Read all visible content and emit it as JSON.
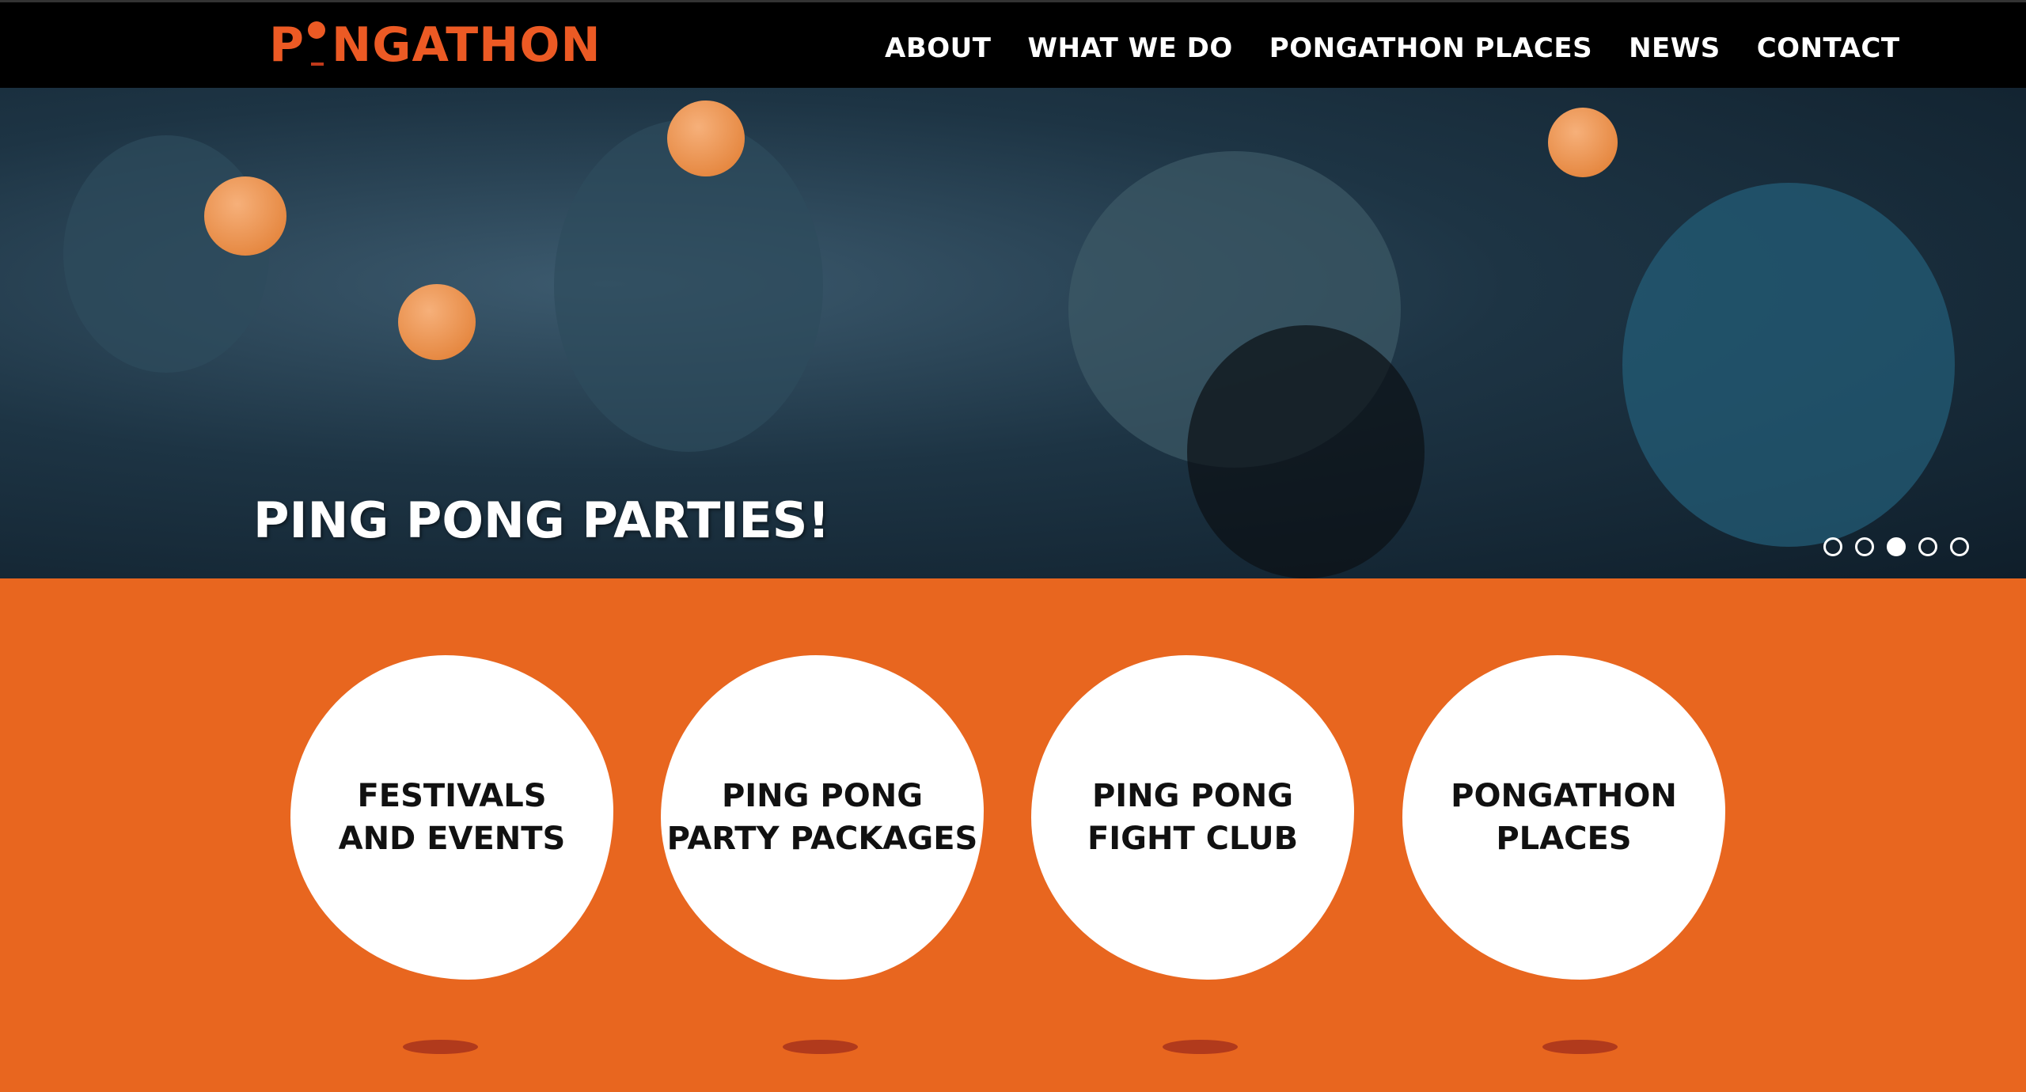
{
  "header": {
    "logo": "PONGATHON",
    "logo_rest": "NGATHON",
    "logo_first": "P",
    "nav": [
      "ABOUT",
      "WHAT WE DO",
      "PONGATHON PLACES",
      "NEWS",
      "CONTACT"
    ]
  },
  "hero": {
    "caption": "PING PONG PARTIES!",
    "slide_count": 5,
    "active_slide": 3
  },
  "features": [
    {
      "line1": "FESTIVALS",
      "line2": "AND EVENTS"
    },
    {
      "line1": "PING PONG",
      "line2": "PARTY PACKAGES"
    },
    {
      "line1": "PING PONG",
      "line2": "FIGHT CLUB"
    },
    {
      "line1": "PONGATHON",
      "line2": "PLACES"
    }
  ],
  "colors": {
    "brand": "#e8661f",
    "logo": "#ec5a24",
    "nav_bg": "#000000"
  }
}
